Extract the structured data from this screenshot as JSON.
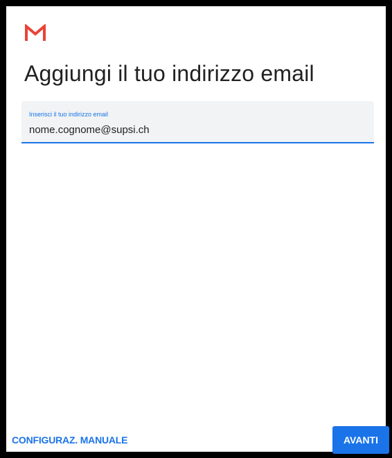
{
  "header": {
    "logo_icon": "gmail-m-icon",
    "title": "Aggiungi il tuo indirizzo email"
  },
  "email": {
    "label": "Inserisci il tuo indirizzo email",
    "value": "nome.cognome@supsi.ch"
  },
  "footer": {
    "manual_label": "CONFIGURAZ. MANUALE",
    "next_label": "AVANTI"
  },
  "colors": {
    "accent": "#1a73e8",
    "logo_red": "#ea4335",
    "field_background": "#f1f3f4",
    "title_text": "#212121"
  }
}
